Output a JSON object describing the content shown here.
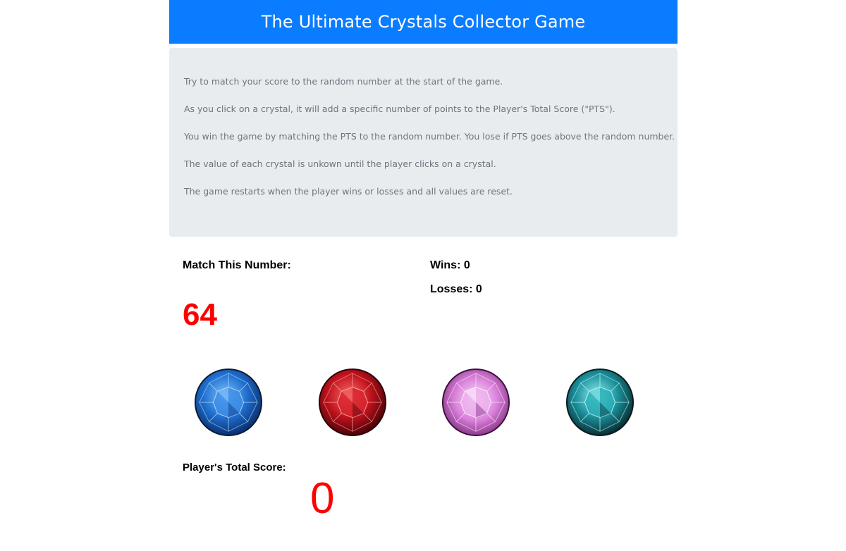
{
  "header": {
    "title": "The Ultimate Crystals Collector Game",
    "color": "#0a7cff"
  },
  "instructions": [
    "Try to match your score to the random number at the start of the game.",
    "As you click on a crystal, it will add a specific number of points to the Player's Total Score (\"PTS\").",
    "You win the game by matching the PTS to the random number. You lose if PTS goes above the random number.",
    "The value of each crystal is unkown until the player clicks on a crystal.",
    "The game restarts when the player wins or losses and all values are reset."
  ],
  "game": {
    "target_label": "Match This Number:",
    "target_number": "64",
    "wins_label": "Wins: 0",
    "losses_label": "Losses: 0",
    "score_label": "Player's Total Score:",
    "score_value": "0"
  },
  "crystals": [
    {
      "name": "blue-crystal",
      "color": "#1f6fd0"
    },
    {
      "name": "red-crystal",
      "color": "#c0121c"
    },
    {
      "name": "pink-crystal",
      "color": "#d97fd9"
    },
    {
      "name": "teal-crystal",
      "color": "#1a8f9a"
    }
  ]
}
